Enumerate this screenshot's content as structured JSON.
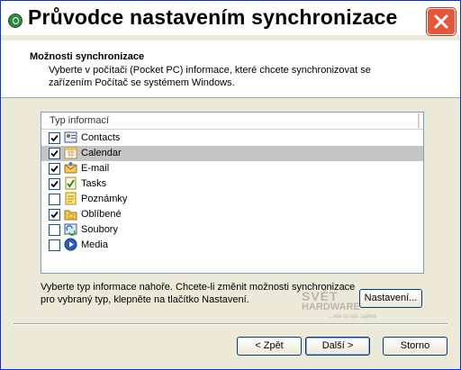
{
  "window": {
    "title": "Průvodce nastavením synchronizace",
    "close_icon": "close-icon"
  },
  "header": {
    "title": "Možnosti synchronizace",
    "description": "Vyberte v počítači (Pocket PC) informace, které chcete synchronizovat se zařízením Počítač se systémem Windows."
  },
  "list": {
    "column_header": "Typ informací",
    "items": [
      {
        "label": "Contacts",
        "checked": true,
        "icon": "contacts-icon",
        "selected": false
      },
      {
        "label": "Calendar",
        "checked": true,
        "icon": "calendar-icon",
        "selected": true
      },
      {
        "label": "E-mail",
        "checked": true,
        "icon": "email-icon",
        "selected": false
      },
      {
        "label": "Tasks",
        "checked": true,
        "icon": "tasks-icon",
        "selected": false
      },
      {
        "label": "Poznámky",
        "checked": false,
        "icon": "notes-icon",
        "selected": false
      },
      {
        "label": "Oblíbené",
        "checked": true,
        "icon": "favorites-icon",
        "selected": false
      },
      {
        "label": "Soubory",
        "checked": false,
        "icon": "files-icon",
        "selected": false
      },
      {
        "label": "Media",
        "checked": false,
        "icon": "media-icon",
        "selected": false
      }
    ]
  },
  "hint": "Vyberte typ informace nahoře. Chcete-li změnit možnosti synchronizace pro vybraný typ, klepněte na tlačítko Nastavení.",
  "buttons": {
    "settings": "Nastavení...",
    "back": "< Zpět",
    "next": "Další >",
    "cancel": "Storno"
  },
  "watermark": {
    "line1": "SVĚT",
    "line2": "HARDWARE",
    "line3": "...vše co vás zajímá"
  },
  "colors": {
    "border": "#0831d9",
    "close_button": "#e4573d",
    "selected_row": "#c5c5c5",
    "dialog_background": "#ece9d8"
  }
}
